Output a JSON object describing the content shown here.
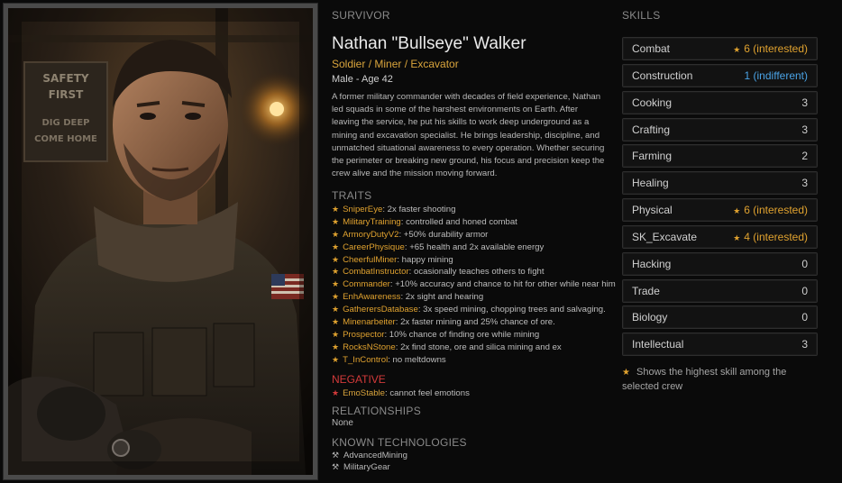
{
  "survivor": {
    "section_title": "SURVIVOR",
    "name": "Nathan \"Bullseye\" Walker",
    "roles": "Soldier / Miner / Excavator",
    "gender_age": "Male - Age 42",
    "bio": "A former military commander with decades of field experience, Nathan led squads in some of the harshest environments on Earth. After leaving the service, he put his skills to work deep underground as a mining and excavation specialist. He brings leadership, discipline, and unmatched situational awareness to every operation. Whether securing the perimeter or breaking new ground, his focus and precision keep the crew alive and the mission moving forward."
  },
  "portrait": {
    "sign_lines": [
      "SAFETY",
      "FIRST",
      "DIG DEEP",
      "COME HOME"
    ]
  },
  "traits": {
    "title": "TRAITS",
    "items": [
      {
        "name": "SniperEye",
        "desc": ": 2x faster shooting"
      },
      {
        "name": "MilitaryTraining",
        "desc": ": controlled and honed combat"
      },
      {
        "name": "ArmoryDutyV2",
        "desc": ": +50% durability armor"
      },
      {
        "name": "CareerPhysique",
        "desc": ": +65 health and 2x available energy"
      },
      {
        "name": "CheerfulMiner",
        "desc": ": happy mining"
      },
      {
        "name": "CombatInstructor",
        "desc": ": ocasionally teaches others to fight"
      },
      {
        "name": "Commander",
        "desc": ": +10% accuracy and chance to hit for other while near him"
      },
      {
        "name": "EnhAwareness",
        "desc": ": 2x sight and hearing"
      },
      {
        "name": "GatherersDatabase",
        "desc": ": 3x speed mining, chopping trees and salvaging."
      },
      {
        "name": "Minenarbeiter",
        "desc": ": 2x faster mining and 25% chance of ore."
      },
      {
        "name": "Prospector",
        "desc": ": 10% chance of finding ore while mining"
      },
      {
        "name": "RocksNStone",
        "desc": ": 2x find stone, ore and silica mining and ex"
      },
      {
        "name": "T_InControl",
        "desc": ": no meltdowns"
      }
    ]
  },
  "negative": {
    "title": "NEGATIVE",
    "items": [
      {
        "name": "EmoStable",
        "desc": ": cannot feel emotions"
      }
    ]
  },
  "relationships": {
    "title": "RELATIONSHIPS",
    "value": "None"
  },
  "technologies": {
    "title": "KNOWN TECHNOLOGIES",
    "items": [
      "AdvancedMining",
      "MilitaryGear"
    ]
  },
  "skills": {
    "title": "SKILLS",
    "items": [
      {
        "name": "Combat",
        "value": "6 (interested)",
        "starred": true,
        "kind": "interested"
      },
      {
        "name": "Construction",
        "value": "1 (indifferent)",
        "starred": false,
        "kind": "indifferent"
      },
      {
        "name": "Cooking",
        "value": "3",
        "starred": false,
        "kind": "normal"
      },
      {
        "name": "Crafting",
        "value": "3",
        "starred": false,
        "kind": "normal"
      },
      {
        "name": "Farming",
        "value": "2",
        "starred": false,
        "kind": "normal"
      },
      {
        "name": "Healing",
        "value": "3",
        "starred": false,
        "kind": "normal"
      },
      {
        "name": "Physical",
        "value": "6 (interested)",
        "starred": true,
        "kind": "interested"
      },
      {
        "name": "SK_Excavate",
        "value": "4 (interested)",
        "starred": true,
        "kind": "interested"
      },
      {
        "name": "Hacking",
        "value": "0",
        "starred": false,
        "kind": "normal"
      },
      {
        "name": "Trade",
        "value": "0",
        "starred": false,
        "kind": "normal"
      },
      {
        "name": "Biology",
        "value": "0",
        "starred": false,
        "kind": "normal"
      },
      {
        "name": "Intellectual",
        "value": "3",
        "starred": false,
        "kind": "normal"
      }
    ],
    "note": "Shows the highest skill among the selected crew"
  },
  "colors": {
    "accent": "#e0a22f",
    "negative": "#d33a3a",
    "indifferent": "#4aa3e6"
  }
}
